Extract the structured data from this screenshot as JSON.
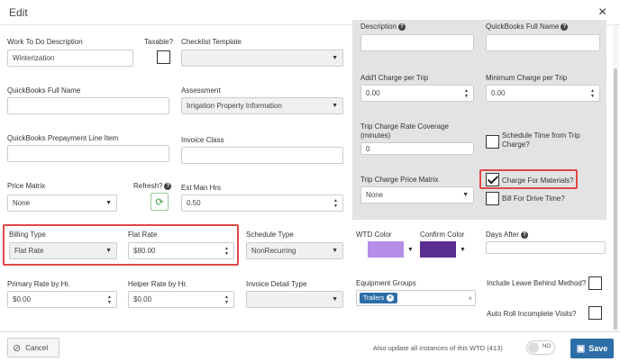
{
  "header": {
    "title": "Edit",
    "close_label": "×"
  },
  "fields": {
    "work_to_do_description": {
      "label": "Work To Do Description",
      "value": "Winterization"
    },
    "taxable": {
      "label": "Taxable?",
      "checked": false
    },
    "checklist_template": {
      "label": "Checklist Template",
      "value": ""
    },
    "quickbooks_full_name_left": {
      "label": "QuickBooks Full Name",
      "value": ""
    },
    "assessment": {
      "label": "Assessment",
      "value": "Irrigation Property Information"
    },
    "qb_prepayment": {
      "label": "QuickBooks Prepayment Line Item",
      "value": ""
    },
    "invoice_class": {
      "label": "Invoice Class",
      "value": ""
    },
    "price_matrix": {
      "label": "Price Matrix",
      "value": "None"
    },
    "refresh": {
      "label": "Refresh?"
    },
    "est_man_hrs": {
      "label": "Est Man Hrs",
      "value": "0.50"
    },
    "billing_type": {
      "label": "Billing Type",
      "value": "Flat Rate"
    },
    "flat_rate": {
      "label": "Flat Rate",
      "value": "$80.00"
    },
    "schedule_type": {
      "label": "Schedule Type",
      "value": "NonRecurring"
    },
    "wtd_color": {
      "label": "WTD Color",
      "color": "#b48ee8"
    },
    "confirm_color": {
      "label": "Confirm Color",
      "color": "#5a2d91"
    },
    "days_after": {
      "label": "Days After",
      "value": ""
    },
    "primary_rate": {
      "label": "Primary Rate by Hr.",
      "value": "$0.00"
    },
    "helper_rate": {
      "label": "Helper Rate by Hr.",
      "value": "$0.00"
    },
    "invoice_detail_type": {
      "label": "Invoice Detail Type",
      "value": ""
    },
    "equipment_groups": {
      "label": "Equipment Groups",
      "tags": [
        "Trailers"
      ],
      "clear": "×"
    },
    "include_leave_behind": {
      "label": "Include Leave Behind Method?",
      "checked": false
    },
    "auto_roll": {
      "label": "Auto Roll Incomplete Visits?",
      "checked": false
    }
  },
  "panel": {
    "description": {
      "label": "Description",
      "value": ""
    },
    "qb_full_name": {
      "label": "QuickBooks Full Name",
      "value": ""
    },
    "addl_charge": {
      "label": "Add'l Charge per Trip",
      "value": "0.00"
    },
    "min_charge": {
      "label": "Minimum Charge per Trip",
      "value": "0.00"
    },
    "trip_coverage": {
      "label": "Trip Charge Rate Coverage (minutes)",
      "value": "0"
    },
    "schedule_time": {
      "label": "Schedule Time from Trip Charge?",
      "checked": false
    },
    "trip_price_matrix": {
      "label": "Trip Charge Price Matrix",
      "value": "None"
    },
    "charge_materials": {
      "label": "Charge For Materials?",
      "checked": true
    },
    "bill_drive_time": {
      "label": "Bill For Drive Time?",
      "checked": false
    }
  },
  "footer": {
    "cancel_label": "Cancel",
    "update_text": "Also update all instances of this WTD (413)",
    "toggle_label": "NO",
    "save_label": "Save"
  },
  "colors": {
    "accent": "#2d6ea8",
    "highlight": "#e04848",
    "refresh": "#3a9a3a"
  }
}
